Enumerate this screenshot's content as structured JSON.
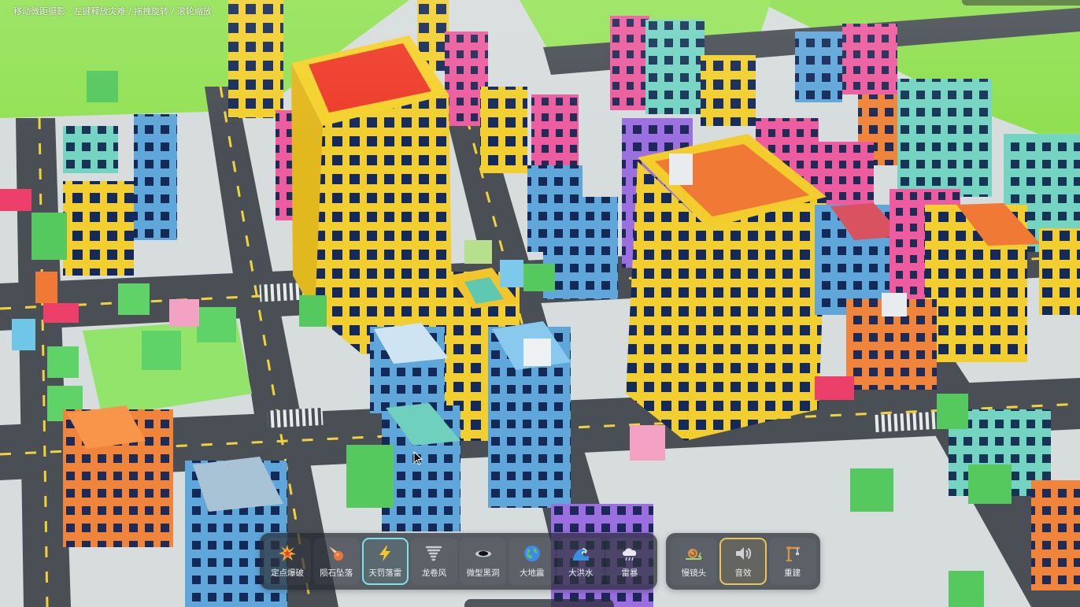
{
  "hint": {
    "text": "· 移动微距摄影 · 左键释放灾难 / 拖拽旋转 / 滚轮缩放"
  },
  "toolbar": {
    "disasters": [
      {
        "label": "定点爆破",
        "icon": "explosion-icon",
        "selected": false
      },
      {
        "label": "陨石坠落",
        "icon": "meteor-icon",
        "selected": false
      },
      {
        "label": "天罚落雷",
        "icon": "lightning-icon",
        "selected": true
      },
      {
        "label": "龙卷风",
        "icon": "tornado-icon",
        "selected": false
      },
      {
        "label": "微型黑洞",
        "icon": "black-hole-icon",
        "selected": false
      },
      {
        "label": "大地震",
        "icon": "globe-icon",
        "selected": false
      },
      {
        "label": "大洪水",
        "icon": "wave-icon",
        "selected": false
      },
      {
        "label": "雷暴",
        "icon": "storm-cloud-icon",
        "selected": false
      }
    ],
    "controls": [
      {
        "label": "慢镜头",
        "icon": "snail-icon",
        "on": false
      },
      {
        "label": "音效",
        "icon": "speaker-icon",
        "on": true
      },
      {
        "label": "重建",
        "icon": "crane-icon",
        "on": false
      }
    ]
  },
  "colors": {
    "selected_disaster_border": "#7fe0ee",
    "active_control_border": "#e6c75a",
    "toolbar_bg": "#242a32",
    "grass": "#8ee04e",
    "road": "#4a4f56"
  }
}
